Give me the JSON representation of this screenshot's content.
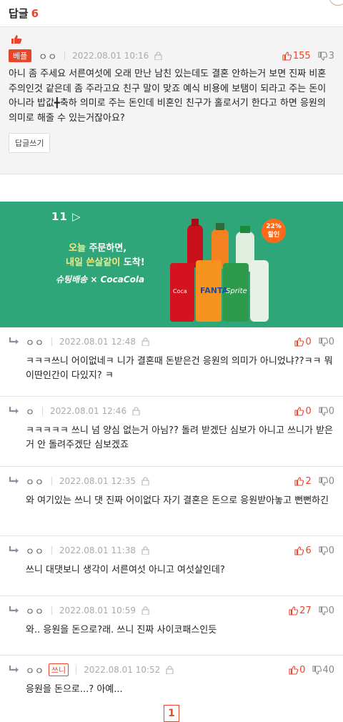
{
  "header": {
    "title": "답글",
    "count": "6"
  },
  "best": {
    "badge": "베플",
    "author": "ㅇㅇ",
    "date": "2022.08.01 10:16",
    "upvotes": "155",
    "downvotes": "3",
    "text": "아니 좀 주세요 서른여섯에 오래 만난 남친 있는데도 결혼 안하는거 보면 진짜 비혼주의인것 같은데 좀 주라고요 친구 말이 맞죠 예식 비용에 보탬이 되라고 주는 돈이 아니라 밥값╋축하 의미로 주는 돈인데 비혼인 친구가 홀로서기 한다고 하면 응원의 의미로 해줄 수 있는거잖아요?",
    "reply_button": "답글쓰기"
  },
  "ad": {
    "brand_logo": "11",
    "line1_hl": "오늘",
    "line1_rest": " 주문하면,",
    "line2_hl": "내일 쓴살같이",
    "line2_rest": " 도착!",
    "brand_line": "슈팅배송 × CocaCola",
    "sale_pct": "22%",
    "sale_label": "할인"
  },
  "comments": [
    {
      "author": "ㅇㅇ",
      "tag": "",
      "date": "2022.08.01 12:48",
      "upvotes": "0",
      "downvotes": "0",
      "text": "ㅋㅋㅋ쓰니 어이없네ㅋ 니가 결혼때 돈받은건 응원의 의미가 아니었냐??ㅋㅋ 뭐 이딴인간이 다있지? ㅋ"
    },
    {
      "author": "ㅇ",
      "tag": "",
      "date": "2022.08.01 12:46",
      "upvotes": "0",
      "downvotes": "0",
      "text": "ㅋㅋㅋㅋㅋ 쓰니 넘 양심 없는거 아님?? 돌려 받겠단 심보가 아니고 쓰니가 받은거 안 돌려주겠단 심보겠죠"
    },
    {
      "author": "ㅇㅇ",
      "tag": "",
      "date": "2022.08.01 12:35",
      "upvotes": "2",
      "downvotes": "0",
      "text": "와 여기있는 쓰니 댓 진짜 어이없다 자기 결혼은 돈으로 응원받아놓고 뻔뻔하긴"
    },
    {
      "author": "ㅇㅇ",
      "tag": "",
      "date": "2022.08.01 11:38",
      "upvotes": "6",
      "downvotes": "0",
      "text": "쓰니 대댓보니 생각이 서른여섯 아니고 여섯살인데?"
    },
    {
      "author": "ㅇㅇ",
      "tag": "",
      "date": "2022.08.01 10:59",
      "upvotes": "27",
      "downvotes": "0",
      "text": "와.. 응원을 돈으로?래. 쓰니 진짜 사이코패스인듯"
    },
    {
      "author": "ㅇㅇ",
      "tag": "쓰니",
      "date": "2022.08.01 10:52",
      "upvotes": "0",
      "downvotes": "40",
      "text": "응원을 돈으로...? 아예..."
    }
  ],
  "pager": {
    "current": "1"
  },
  "colors": {
    "accent": "#e8452b",
    "ad_bg": "#2fa57a"
  }
}
